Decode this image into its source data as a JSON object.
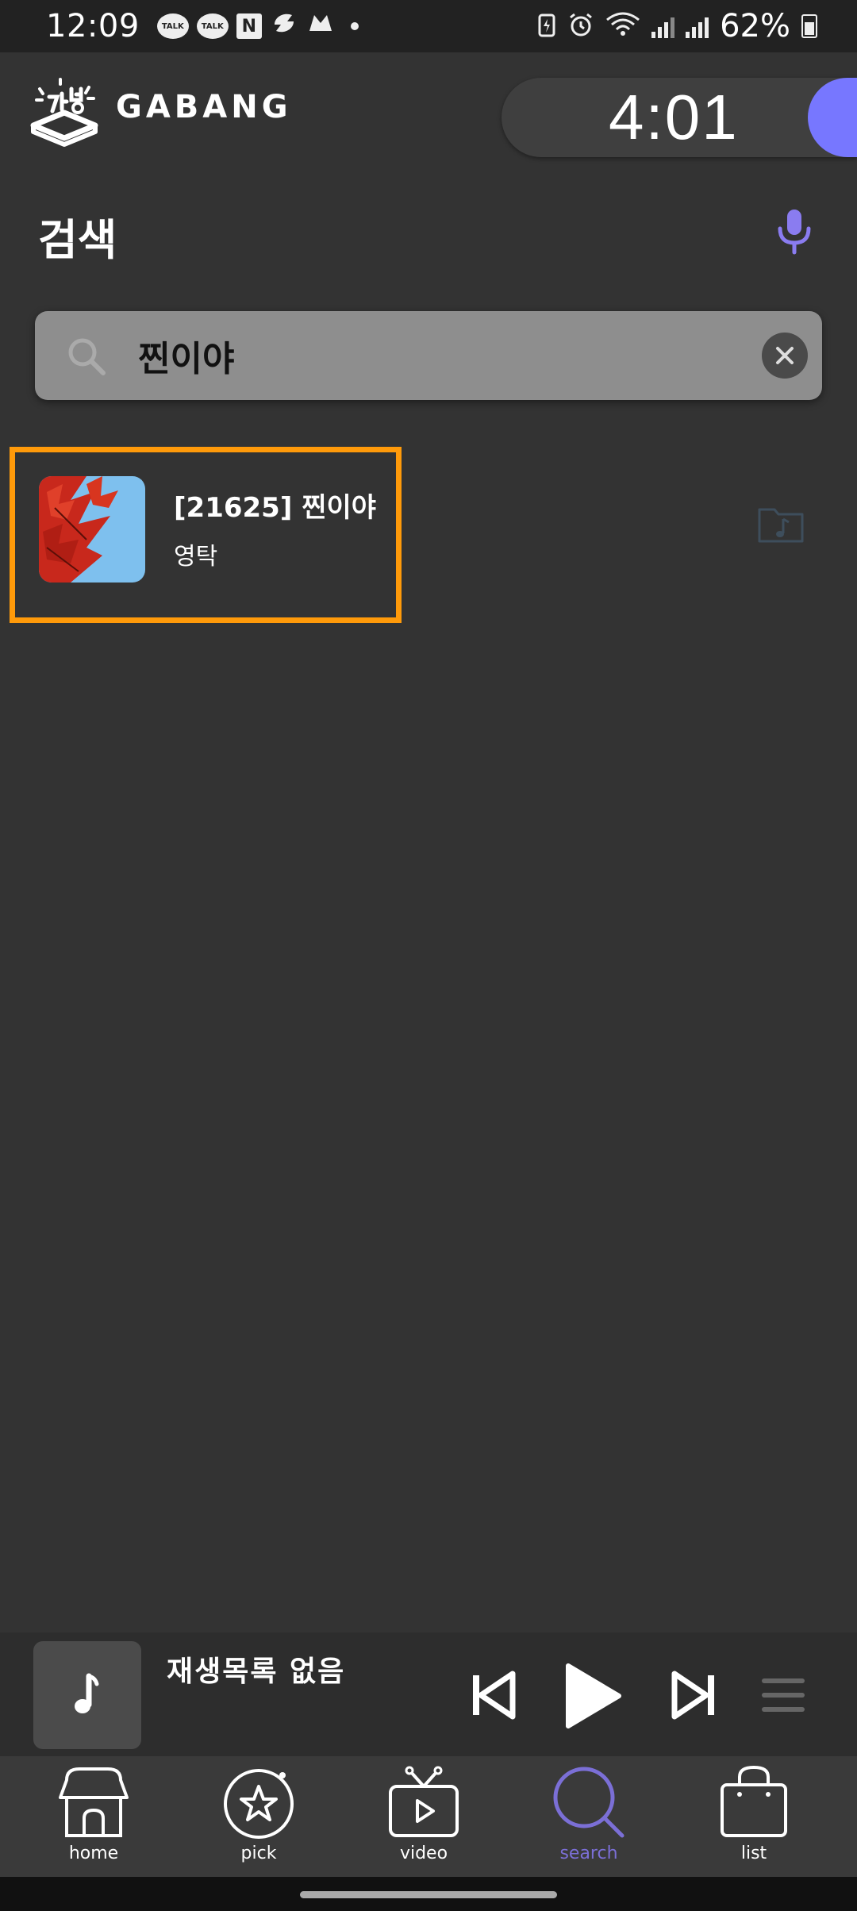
{
  "status_bar": {
    "time": "12:09",
    "kakao_badge_1": "TALK",
    "kakao_badge_2": "TALK",
    "naver_letter": "N",
    "battery_pct": "62%"
  },
  "header": {
    "brand": "GABANG",
    "timer": "4:01",
    "accent_color": "#7777ff"
  },
  "page": {
    "title": "검색"
  },
  "search": {
    "query": "찐이야"
  },
  "results": [
    {
      "title": "[21625] 찐이야",
      "artist": "영탁"
    }
  ],
  "player": {
    "status": "재생목록 없음"
  },
  "nav": {
    "items": [
      {
        "label": "home",
        "icon": "house-icon"
      },
      {
        "label": "pick",
        "icon": "star-icon"
      },
      {
        "label": "video",
        "icon": "tv-icon"
      },
      {
        "label": "search",
        "icon": "search-icon"
      },
      {
        "label": "list",
        "icon": "bag-icon"
      }
    ],
    "active": "search",
    "active_color": "#7b6fd6"
  },
  "highlight_color": "#ff9a0a"
}
